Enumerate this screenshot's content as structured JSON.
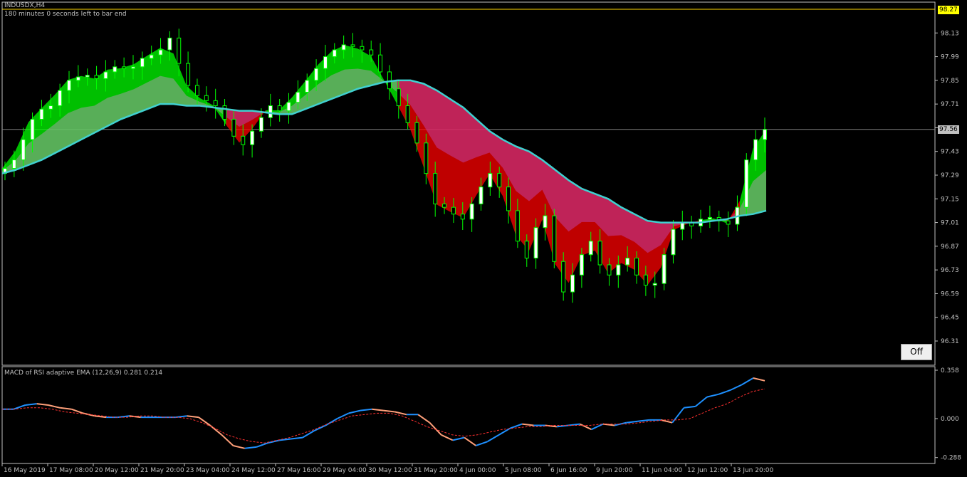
{
  "header": {
    "symbol": "INDUSDX,H4",
    "timer": "180 minutes 0 seconds left to bar end"
  },
  "price_tags": {
    "top": "98.27",
    "current": "97.56"
  },
  "off_button": "Off",
  "colors": {
    "background": "#000000",
    "bull": "#00ff00",
    "bear": "#ff0000",
    "ema": "#40d0d0",
    "macd": "#1e90ff",
    "macd_down": "#ffa07a",
    "signal": "#ff3030"
  },
  "chart_data": [
    {
      "type": "candlestick",
      "title": "INDUSDX,H4",
      "ylim": [
        96.24,
        98.27
      ],
      "yticks": [
        "98.13",
        "97.99",
        "97.85",
        "97.71",
        "97.57",
        "97.43",
        "97.29",
        "97.15",
        "97.01",
        "96.87",
        "96.73",
        "96.59",
        "96.45",
        "96.31"
      ],
      "x_labels": [
        "16 May 2019",
        "17 May 08:00",
        "20 May 12:00",
        "21 May 20:00",
        "23 May 04:00",
        "24 May 12:00",
        "27 May 16:00",
        "29 May 04:00",
        "30 May 12:00",
        "31 May 20:00",
        "4 Jun 00:00",
        "5 Jun 08:00",
        "6 Jun 16:00",
        "9 Jun 20:00",
        "11 Jun 04:00",
        "12 Jun 12:00",
        "13 Jun 20:00"
      ],
      "current_price": 97.56,
      "close": [
        97.33,
        97.38,
        97.5,
        97.62,
        97.68,
        97.7,
        97.79,
        97.85,
        97.87,
        97.88,
        97.86,
        97.9,
        97.93,
        97.92,
        97.93,
        97.98,
        98.0,
        98.03,
        98.1,
        97.95,
        97.82,
        97.76,
        97.73,
        97.7,
        97.62,
        97.52,
        97.47,
        97.55,
        97.63,
        97.7,
        97.67,
        97.72,
        97.78,
        97.85,
        97.92,
        97.99,
        98.03,
        98.06,
        98.05,
        98.03,
        98.0,
        97.9,
        97.8,
        97.7,
        97.6,
        97.48,
        97.3,
        97.12,
        97.1,
        97.06,
        97.03,
        97.12,
        97.22,
        97.3,
        97.22,
        97.08,
        96.9,
        96.8,
        96.98,
        97.05,
        96.78,
        96.6,
        96.7,
        96.82,
        96.9,
        96.76,
        96.7,
        96.76,
        96.8,
        96.7,
        96.64,
        96.65,
        96.82,
        96.97,
        97.01,
        96.99,
        97.03,
        97.04,
        97.02,
        97.0,
        97.1,
        97.38,
        97.5,
        97.56
      ],
      "ema_line": [
        97.3,
        97.32,
        97.35,
        97.38,
        97.42,
        97.46,
        97.5,
        97.54,
        97.58,
        97.62,
        97.65,
        97.68,
        97.71,
        97.71,
        97.7,
        97.7,
        97.69,
        97.68,
        97.67,
        97.67,
        97.66,
        97.65,
        97.65,
        97.68,
        97.71,
        97.74,
        97.77,
        97.8,
        97.82,
        97.84,
        97.85,
        97.85,
        97.83,
        97.79,
        97.74,
        97.69,
        97.62,
        97.55,
        97.5,
        97.46,
        97.43,
        97.38,
        97.32,
        97.26,
        97.21,
        97.18,
        97.15,
        97.1,
        97.06,
        97.02,
        97.01,
        97.01,
        97.01,
        97.01,
        97.02,
        97.03,
        97.05,
        97.06,
        97.08
      ],
      "macd_panel": {
        "title": "MACD of RSI adaptive EMA (12,26,9) 0.281 0.214",
        "yticks": [
          "0.358",
          "0.000",
          "-0.288"
        ],
        "ylim": [
          -0.288,
          0.358
        ],
        "series": [
          {
            "name": "MACD",
            "values": [
              0.07,
              0.07,
              0.1,
              0.11,
              0.1,
              0.08,
              0.07,
              0.04,
              0.02,
              0.01,
              0.01,
              0.02,
              0.01,
              0.01,
              0.01,
              0.01,
              0.02,
              0.01,
              -0.05,
              -0.12,
              -0.2,
              -0.22,
              -0.21,
              -0.18,
              -0.16,
              -0.15,
              -0.14,
              -0.09,
              -0.05,
              0.0,
              0.04,
              0.06,
              0.07,
              0.06,
              0.05,
              0.03,
              0.03,
              -0.03,
              -0.12,
              -0.16,
              -0.14,
              -0.2,
              -0.17,
              -0.12,
              -0.07,
              -0.04,
              -0.05,
              -0.05,
              -0.06,
              -0.05,
              -0.04,
              -0.08,
              -0.04,
              -0.05,
              -0.03,
              -0.02,
              -0.01,
              -0.01,
              -0.03,
              0.08,
              0.09,
              0.16,
              0.18,
              0.21,
              0.25,
              0.3,
              0.28
            ]
          },
          {
            "name": "Signal",
            "values": [
              0.07,
              0.07,
              0.08,
              0.08,
              0.07,
              0.05,
              0.04,
              0.03,
              0.02,
              0.01,
              0.01,
              0.02,
              0.02,
              0.01,
              0.01,
              0.0,
              -0.03,
              -0.07,
              -0.12,
              -0.15,
              -0.17,
              -0.18,
              -0.16,
              -0.14,
              -0.11,
              -0.08,
              -0.04,
              -0.01,
              0.02,
              0.03,
              0.04,
              0.04,
              0.02,
              -0.02,
              -0.06,
              -0.09,
              -0.12,
              -0.13,
              -0.12,
              -0.1,
              -0.08,
              -0.07,
              -0.06,
              -0.06,
              -0.05,
              -0.05,
              -0.05,
              -0.05,
              -0.04,
              -0.04,
              -0.04,
              -0.03,
              -0.02,
              -0.01,
              -0.01,
              0.0,
              0.04,
              0.08,
              0.11,
              0.16,
              0.2,
              0.22
            ]
          }
        ]
      }
    }
  ]
}
